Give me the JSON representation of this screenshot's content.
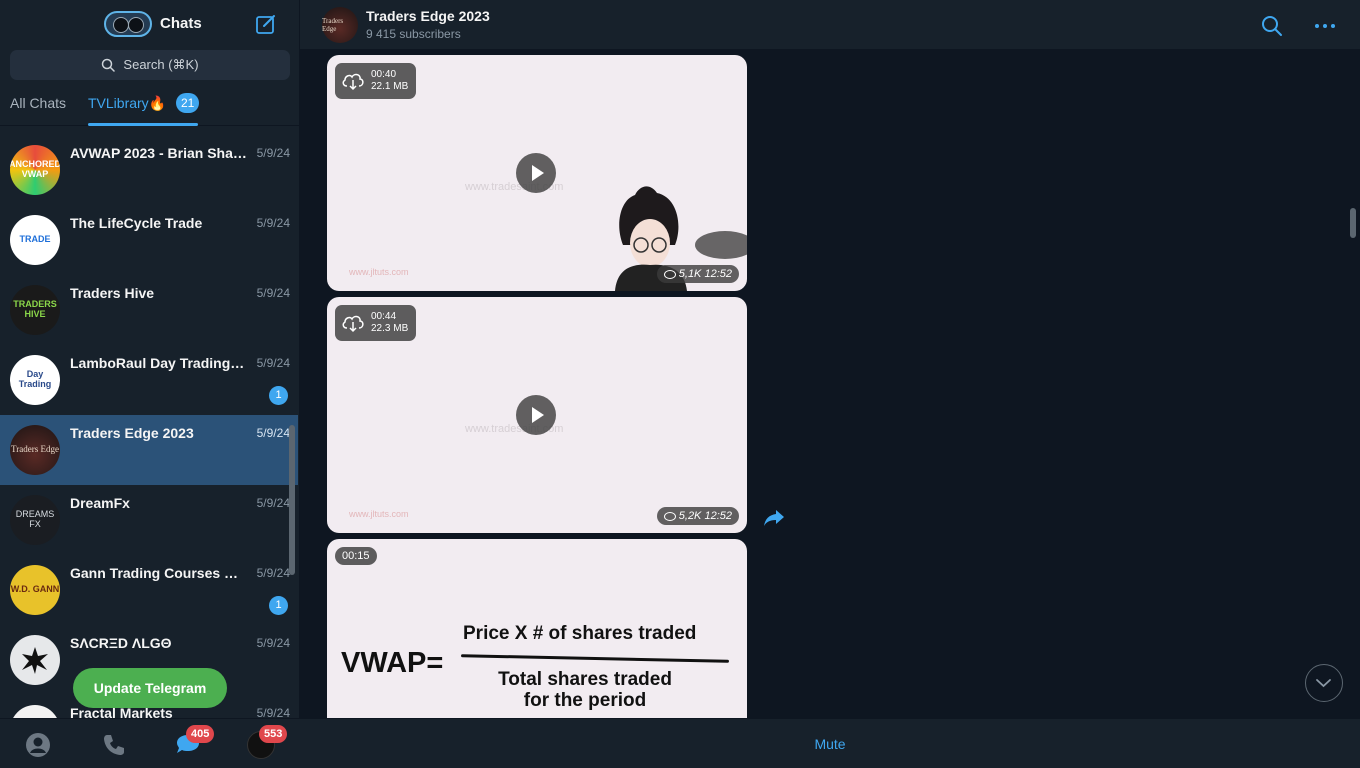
{
  "sidebar": {
    "title": "Chats",
    "search_placeholder": "Search (⌘K)",
    "tabs": [
      {
        "label": "All Chats"
      },
      {
        "label": "TVLibrary🔥",
        "badge": "21"
      }
    ],
    "chats": [
      {
        "name": "AVWAP 2023 - Brian Shannon",
        "date": "5/9/24",
        "avatar_text": "ANCHORED VWAP"
      },
      {
        "name": "The LifeCycle Trade",
        "date": "5/9/24",
        "avatar_text": "TRADE"
      },
      {
        "name": "Traders Hive",
        "date": "5/9/24",
        "avatar_text": "TRADERS HIVE"
      },
      {
        "name": "LamboRaul Day Trading Institution",
        "date": "5/9/24",
        "avatar_text": "Day Trading",
        "unread": "1"
      },
      {
        "name": "Traders Edge 2023",
        "date": "5/9/24",
        "avatar_text": "Traders Edge"
      },
      {
        "name": "DreamFx",
        "date": "5/9/24",
        "avatar_text": "DREAMS FX"
      },
      {
        "name": "Gann Trading Courses & Books",
        "date": "5/9/24",
        "avatar_text": "W.D. GANN",
        "unread": "1"
      },
      {
        "name": "SΛCRΞD ΛLGΘ",
        "date": "5/9/24",
        "avatar_text": ""
      },
      {
        "name": "Fractal Markets",
        "date": "5/9/24",
        "avatar_text": ""
      }
    ],
    "update_button": "Update Telegram",
    "nav": {
      "chats_badge": "405",
      "profile_badge": "553"
    }
  },
  "header": {
    "title": "Traders Edge 2023",
    "subtitle": "9 415 subscribers",
    "avatar_text": "Traders Edge"
  },
  "messages": [
    {
      "duration": "00:40",
      "size": "22.1 MB",
      "views": "5,1K",
      "time": "12:52",
      "watermark": "www.tradesaint.com"
    },
    {
      "duration": "00:44",
      "size": "22.3 MB",
      "views": "5,2K",
      "time": "12:52",
      "watermark": "www.tradesaint.com"
    },
    {
      "duration": "00:15",
      "formula": {
        "lhs": "VWAP=",
        "numerator": "Price X # of shares traded",
        "denominator_1": "Total shares traded",
        "denominator_2": "for the period"
      }
    }
  ],
  "footer": {
    "mute_label": "Mute"
  },
  "colors": {
    "accent": "#3fa7f0",
    "active_chat": "#2b5278",
    "update_green": "#4caf50",
    "badge_red": "#e0474c"
  }
}
